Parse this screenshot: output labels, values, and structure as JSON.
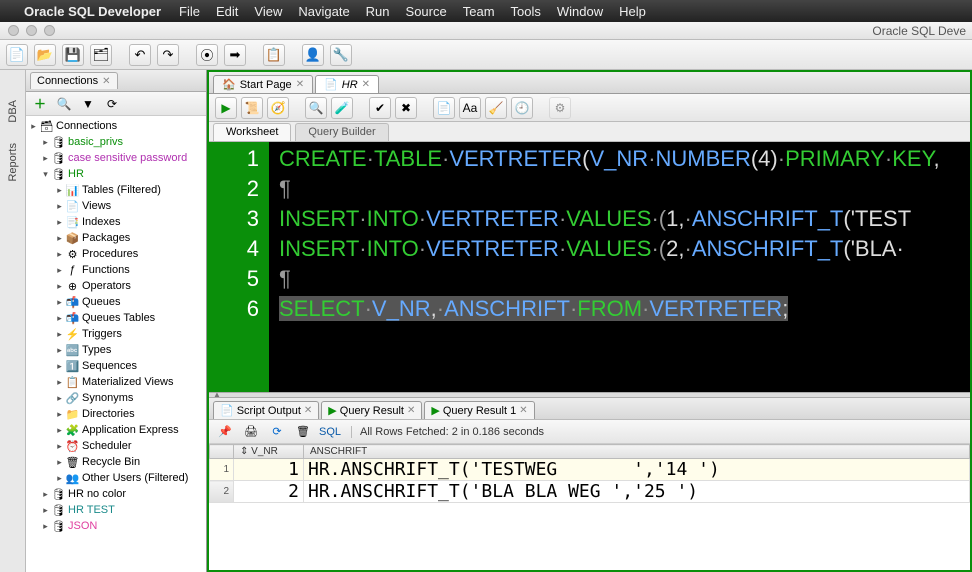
{
  "menubar": {
    "apple": "",
    "app": "Oracle SQL Developer",
    "items": [
      "File",
      "Edit",
      "View",
      "Navigate",
      "Run",
      "Source",
      "Team",
      "Tools",
      "Window",
      "Help"
    ]
  },
  "window_title": "Oracle SQL Deve",
  "side_vtabs": [
    "DBA",
    "Reports"
  ],
  "connections": {
    "tab_label": "Connections",
    "root": "Connections",
    "items": [
      {
        "label": "basic_privs",
        "cls": "green"
      },
      {
        "label": "case sensitive password",
        "cls": "purple"
      },
      {
        "label": "HR",
        "cls": "green",
        "expanded": true
      }
    ],
    "hr_children": [
      "Tables (Filtered)",
      "Views",
      "Indexes",
      "Packages",
      "Procedures",
      "Functions",
      "Operators",
      "Queues",
      "Queues Tables",
      "Triggers",
      "Types",
      "Sequences",
      "Materialized Views",
      "Synonyms",
      "Directories",
      "Application Express",
      "Scheduler",
      "Recycle Bin",
      "Other Users (Filtered)"
    ],
    "after": [
      {
        "label": "HR no color",
        "cls": ""
      },
      {
        "label": "HR TEST",
        "cls": "teal"
      },
      {
        "label": "JSON",
        "cls": "pink"
      }
    ]
  },
  "editor": {
    "tabs": [
      {
        "label": "Start Page",
        "icon": "🏠"
      },
      {
        "label": "HR",
        "icon": "📄",
        "italic": true
      }
    ],
    "wstabs": [
      "Worksheet",
      "Query Builder"
    ],
    "gutter": [
      "1",
      "2",
      "3",
      "4",
      "5",
      "6"
    ],
    "code_html": [
      [
        [
          "kw",
          "CREATE"
        ],
        [
          "op",
          "·"
        ],
        [
          "kw",
          "TABLE"
        ],
        [
          "op",
          "·"
        ],
        [
          "id",
          "VERTRETER"
        ],
        [
          "lit",
          "("
        ],
        [
          "id",
          "V_NR"
        ],
        [
          "op",
          "·"
        ],
        [
          "id",
          "NUMBER"
        ],
        [
          "lit",
          "(4)"
        ],
        [
          "op",
          "·"
        ],
        [
          "kw",
          "PRIMARY"
        ],
        [
          "op",
          "·"
        ],
        [
          "kw",
          "KEY"
        ],
        [
          "lit",
          ","
        ]
      ],
      [
        [
          "op",
          "¶"
        ]
      ],
      [
        [
          "kw",
          "INSERT"
        ],
        [
          "op",
          "·"
        ],
        [
          "kw",
          "INTO"
        ],
        [
          "op",
          "·"
        ],
        [
          "id",
          "VERTRETER"
        ],
        [
          "op",
          "·"
        ],
        [
          "kw",
          "VALUES"
        ],
        [
          "op",
          "·("
        ],
        [
          "lit",
          "1"
        ],
        [
          "lit",
          ","
        ],
        [
          "op",
          "·"
        ],
        [
          "id",
          "ANSCHRIFT_T"
        ],
        [
          "lit",
          "('TEST"
        ]
      ],
      [
        [
          "kw",
          "INSERT"
        ],
        [
          "op",
          "·"
        ],
        [
          "kw",
          "INTO"
        ],
        [
          "op",
          "·"
        ],
        [
          "id",
          "VERTRETER"
        ],
        [
          "op",
          "·"
        ],
        [
          "kw",
          "VALUES"
        ],
        [
          "op",
          "·("
        ],
        [
          "lit",
          "2"
        ],
        [
          "lit",
          ","
        ],
        [
          "op",
          "·"
        ],
        [
          "id",
          "ANSCHRIFT_T"
        ],
        [
          "lit",
          "('BLA·"
        ]
      ],
      [
        [
          "op",
          "¶"
        ]
      ],
      [
        [
          "sel",
          "<kw>SELECT</kw><op>·</op><id>V_NR</id><lit>,</lit><op>·</op><id>ANSCHRIFT</id><op>·</op><kw>FROM</kw><op>·</op><id>VERTRETER</id><lit>;</lit>"
        ]
      ]
    ]
  },
  "results": {
    "tabs": [
      {
        "label": "Script Output",
        "icon": "📄"
      },
      {
        "label": "Query Result",
        "icon": "▶"
      },
      {
        "label": "Query Result 1",
        "icon": "▶"
      }
    ],
    "sql_label": "SQL",
    "status": "All Rows Fetched: 2 in 0.186 seconds",
    "cols": [
      "",
      "V_NR",
      "ANSCHRIFT"
    ],
    "rows": [
      {
        "n": "1",
        "vnr": "1",
        "a": "HR.ANSCHRIFT_T('TESTWEG       ','14 ')"
      },
      {
        "n": "2",
        "vnr": "2",
        "a": "HR.ANSCHRIFT_T('BLA BLA WEG ','25 ')"
      }
    ]
  }
}
